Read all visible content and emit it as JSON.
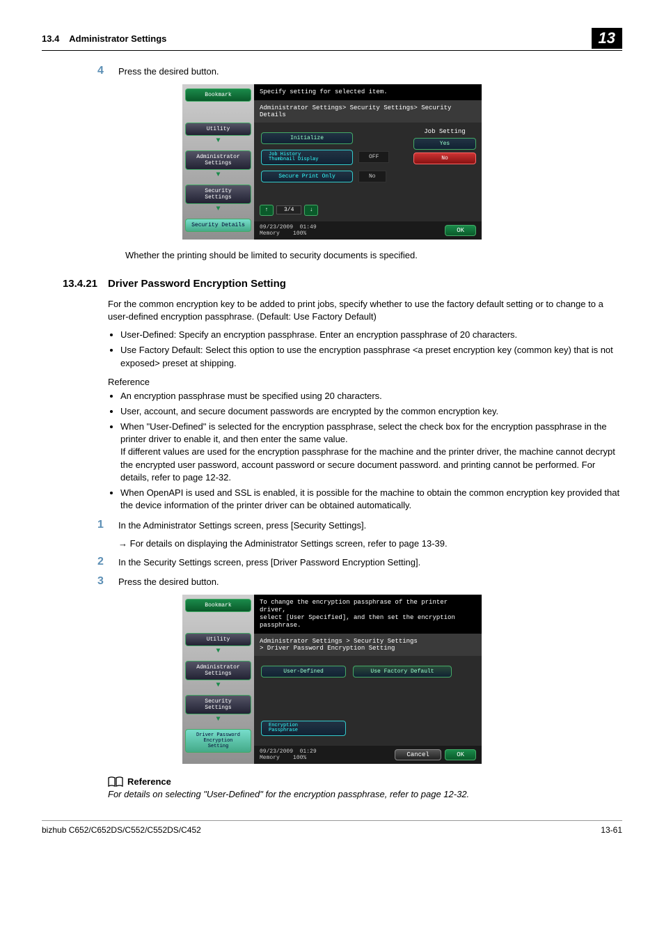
{
  "header": {
    "section": "13.4",
    "title": "Administrator Settings",
    "chapter": "13"
  },
  "step4": {
    "num": "4",
    "text": "Press the desired button."
  },
  "caption1": "Whether the printing should be limited to security documents is specified.",
  "section": {
    "num": "13.4.21",
    "title": "Driver Password Encryption Setting"
  },
  "para1": "For the common encryption key to be added to print jobs, specify whether to use the factory default setting or to change to a user-defined encryption passphrase. (Default: Use Factory Default)",
  "bullets1": [
    "User-Defined: Specify an encryption passphrase. Enter an encryption passphrase of 20 characters.",
    "Use Factory Default: Select this option to use the encryption passphrase <a preset encryption key (common key) that is not exposed> preset at shipping."
  ],
  "referenceLabel": "Reference",
  "bullets2": [
    "An encryption passphrase must be specified using 20 characters.",
    "User, account, and secure document passwords are encrypted by the common encryption key.",
    "When \"User-Defined\" is selected for the encryption passphrase, select the check box for the encryption passphrase in the printer driver to enable it, and then enter the same value.\nIf different values are used for the encryption passphrase for the machine and the printer driver, the machine cannot decrypt the encrypted user password, account password or secure document password. and printing cannot be performed. For details, refer to page 12-32.",
    "When OpenAPI is used and SSL is enabled, it is possible for the machine to obtain the common encryption key provided that the device information of the printer driver can be obtained automatically."
  ],
  "step1": {
    "num": "1",
    "text": "In the Administrator Settings screen, press [Security Settings].",
    "sub": "For details on displaying the Administrator Settings screen, refer to page 13-39."
  },
  "step2": {
    "num": "2",
    "text": "In the Security Settings screen, press [Driver Password Encryption Setting]."
  },
  "step3": {
    "num": "3",
    "text": "Press the desired button."
  },
  "refBox": {
    "title": "Reference",
    "text": "For details on selecting \"User-Defined\" for the encryption passphrase, refer to page 12-32."
  },
  "footer": {
    "left": "bizhub C652/C652DS/C552/C552DS/C452",
    "right": "13-61"
  },
  "ss1": {
    "instr": "Specify setting for selected item.",
    "crumb": "Administrator Settings> Security Settings> Security Details",
    "side": {
      "bookmark": "Bookmark",
      "utility": "Utility",
      "admin": "Administrator\nSettings",
      "sec": "Security\nSettings",
      "detail": "Security Details"
    },
    "rows": {
      "initialize": "Initialize",
      "jobhist": "Job History\nThumbnail Display",
      "jobhist_val": "OFF",
      "secure": "Secure Print Only",
      "secure_val": "No"
    },
    "rightcol": {
      "label": "Job Setting",
      "yes": "Yes",
      "no": "No"
    },
    "pager": "3/4",
    "date": "09/23/2009",
    "time": "01:49",
    "mem": "Memory",
    "mempct": "100%",
    "ok": "OK"
  },
  "ss2": {
    "instr": "To change the encryption passphrase of the printer driver,\nselect [User Specified], and then set the encryption passphrase.",
    "crumb": "Administrator Settings > Security Settings\n> Driver Password Encryption Setting",
    "side": {
      "bookmark": "Bookmark",
      "utility": "Utility",
      "admin": "Administrator\nSettings",
      "sec": "Security\nSettings",
      "drv": "Driver Password\nEncryption\nSetting"
    },
    "tabs": {
      "user": "User-Defined",
      "factory": "Use Factory Default"
    },
    "enc": "Encryption\nPassphrase",
    "date": "09/23/2009",
    "time": "01:29",
    "mem": "Memory",
    "mempct": "100%",
    "cancel": "Cancel",
    "ok": "OK"
  }
}
